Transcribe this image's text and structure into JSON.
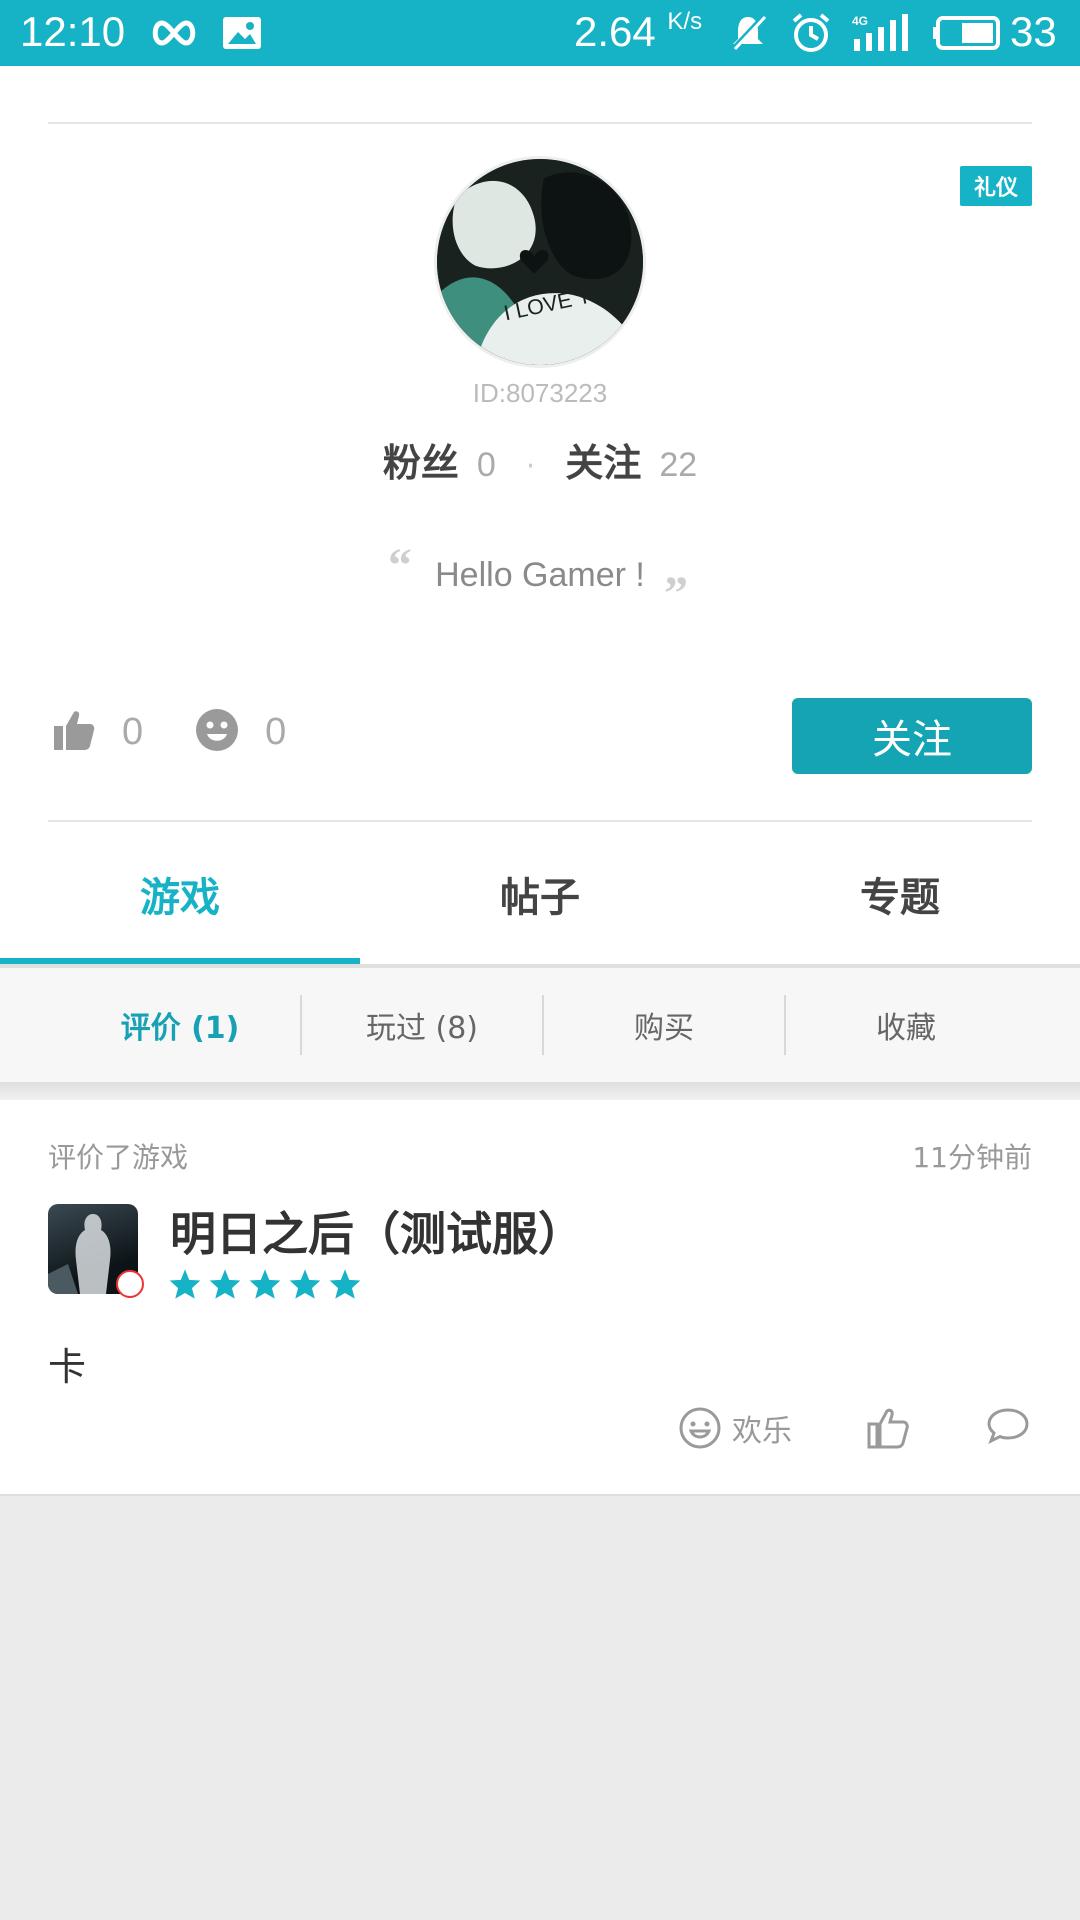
{
  "status_bar": {
    "time": "12:10",
    "speed_value": "2.64",
    "speed_unit": "K/s",
    "battery": "33"
  },
  "profile": {
    "badge": "礼仪",
    "user_id": "ID:8073223",
    "fans_label": "粉丝",
    "fans_count": "0",
    "following_label": "关注",
    "following_count": "22",
    "motto": "Hello Gamer !",
    "likes_count": "0",
    "smiles_count": "0",
    "follow_button": "关注"
  },
  "tabs": [
    {
      "label": "游戏",
      "active": true
    },
    {
      "label": "帖子",
      "active": false
    },
    {
      "label": "专题",
      "active": false
    }
  ],
  "subtabs": [
    {
      "label": "评价 (1)",
      "active": true
    },
    {
      "label": "玩过 (8)",
      "active": false
    },
    {
      "label": "购买",
      "active": false
    },
    {
      "label": "收藏",
      "active": false
    }
  ],
  "review": {
    "action": "评价了游戏",
    "time": "11分钟前",
    "game_title": "明日之后（测试服）",
    "rating": 5,
    "text": "卡",
    "reaction_label": "欢乐"
  },
  "colors": {
    "accent": "#16b3c6",
    "button": "#14a4b3"
  }
}
